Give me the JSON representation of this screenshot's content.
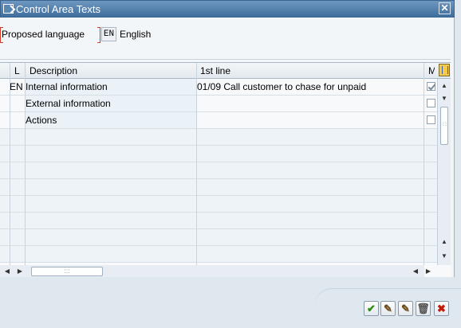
{
  "window": {
    "title": "Control Area Texts",
    "close_icon": "close-icon"
  },
  "language": {
    "label": "Proposed language",
    "code": "EN",
    "name": "English"
  },
  "table": {
    "headers": {
      "lang": "L",
      "description": "Description",
      "first_line": "1st line",
      "more": "M"
    },
    "rows": [
      {
        "lang": "EN",
        "description": "Internal information",
        "first_line": "01/09  Call customer to chase for unpaid",
        "checked": true
      },
      {
        "lang": "",
        "description": "External information",
        "first_line": "",
        "checked": false
      },
      {
        "lang": "",
        "description": "Actions",
        "first_line": "",
        "checked": false
      }
    ],
    "empty_rows": 8
  },
  "footer": {
    "buttons": [
      "confirm-icon",
      "edit-icon",
      "edit-icon",
      "delete-icon",
      "cancel-icon"
    ]
  }
}
